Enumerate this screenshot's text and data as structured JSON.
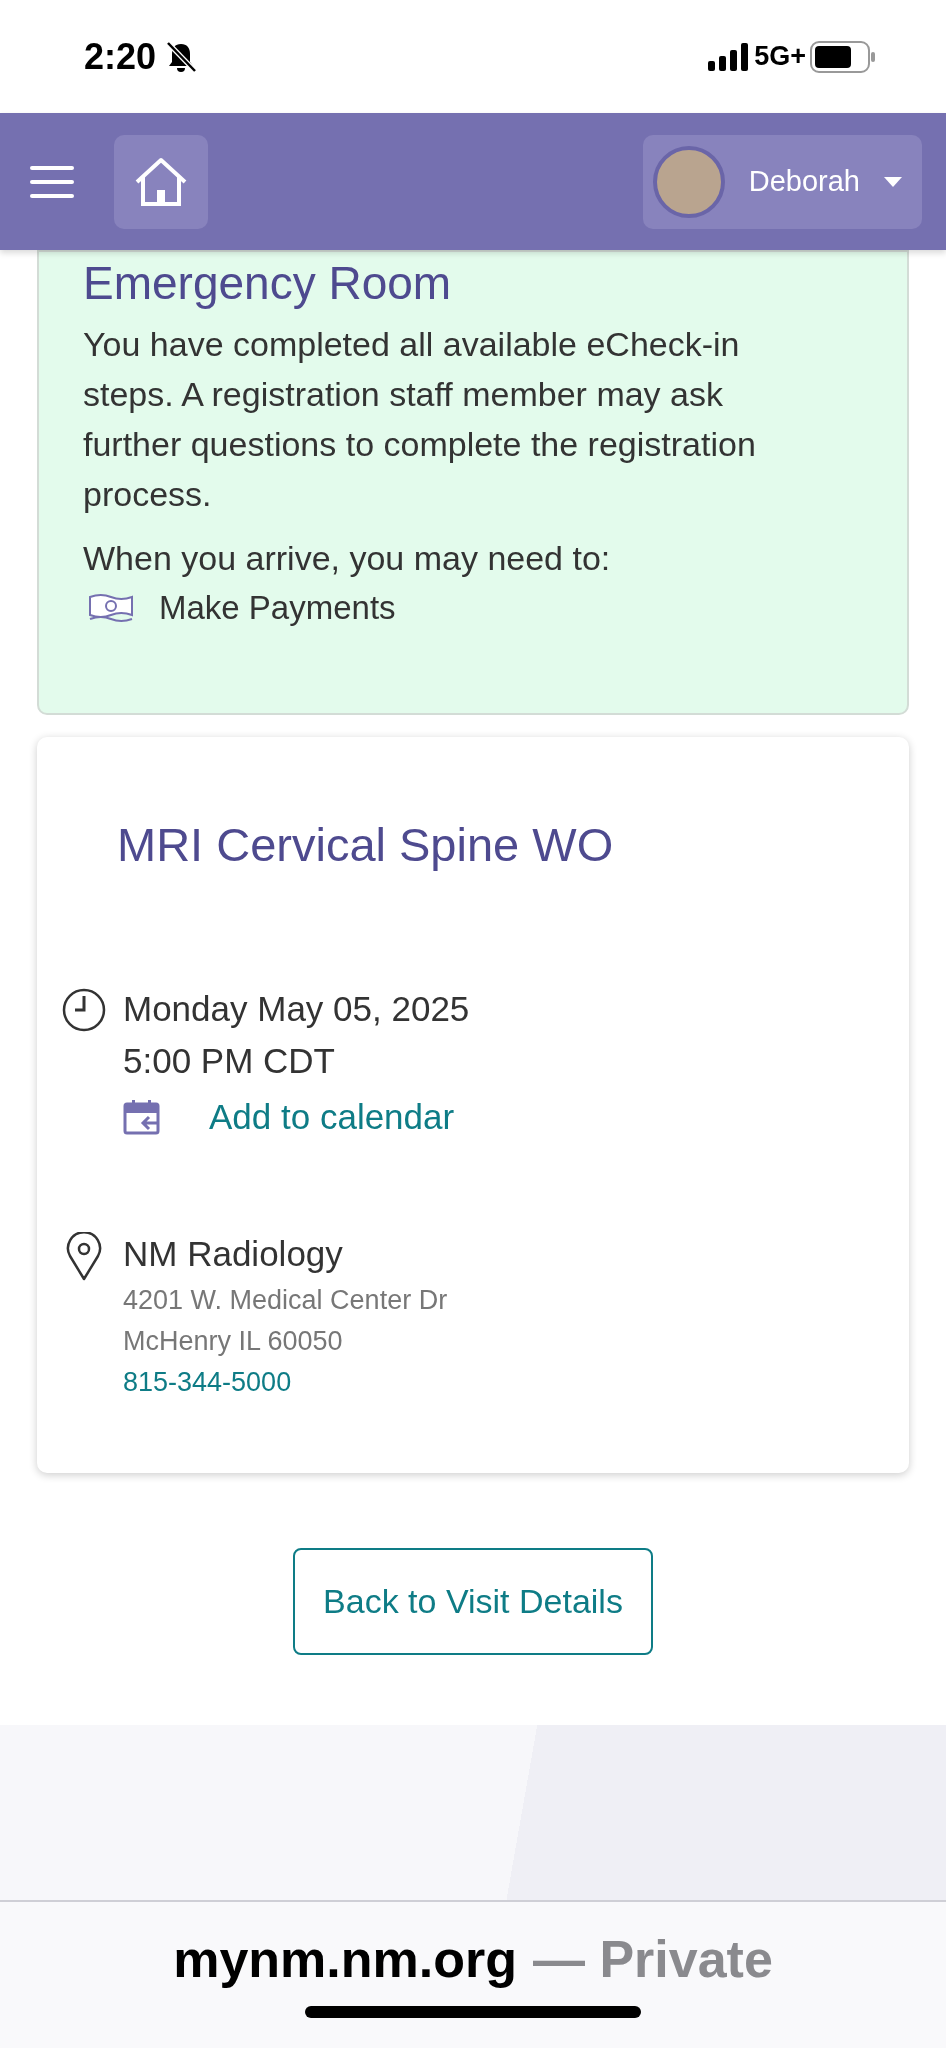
{
  "status_bar": {
    "time": "2:20",
    "network": "5G+"
  },
  "navbar": {
    "user_name": "Deborah"
  },
  "checkin_card": {
    "title": "Emergency Room",
    "message": "You have completed all available eCheck-in steps. A registration staff member may ask further questions to complete the registration process.",
    "arrive_prompt": "When you arrive, you may need to:",
    "tasks": [
      {
        "label": "Make Payments"
      }
    ]
  },
  "appointment": {
    "title": "MRI Cervical Spine WO",
    "date": "Monday May 05, 2025",
    "time": "5:00 PM CDT",
    "add_to_calendar": "Add to calendar",
    "location": {
      "name": "NM Radiology",
      "address_lines": [
        "4201 W. Medical Center Dr",
        "McHenry IL 60050"
      ],
      "phone": "815-344-5000"
    }
  },
  "back_button": "Back to Visit Details",
  "browser_bar": {
    "domain": "mynm.nm.org",
    "mode": "— Private"
  }
}
